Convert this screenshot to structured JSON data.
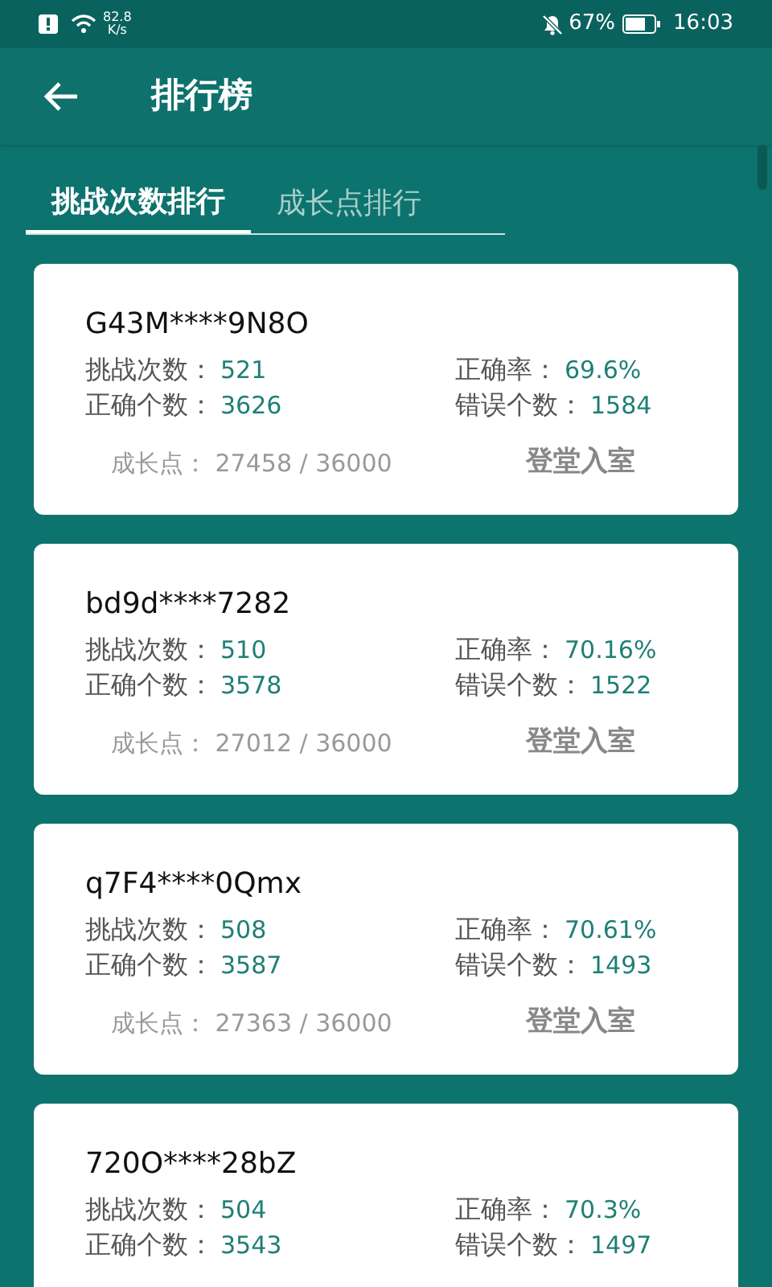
{
  "status_bar": {
    "speed": "82.8",
    "speed_unit": "K/s",
    "battery": "67%",
    "time": "16:03"
  },
  "app_bar": {
    "title": "排行榜"
  },
  "tabs": [
    {
      "label": "挑战次数排行",
      "selected": true
    },
    {
      "label": "成长点排行",
      "selected": false
    }
  ],
  "entries": [
    {
      "user": "G43M****9N8O",
      "challenges_label": "挑战次数：",
      "challenges": "521",
      "accuracy_label": "正确率：",
      "accuracy": "69.6%",
      "correct_label": "正确个数：",
      "correct": "3626",
      "wrong_label": "错误个数：",
      "wrong": "1584",
      "growth": "成长点：  27458 / 36000",
      "rank": "登堂入室"
    },
    {
      "user": "bd9d****7282",
      "challenges_label": "挑战次数：",
      "challenges": "510",
      "accuracy_label": "正确率：",
      "accuracy": "70.16%",
      "correct_label": "正确个数：",
      "correct": "3578",
      "wrong_label": "错误个数：",
      "wrong": "1522",
      "growth": "成长点：  27012 / 36000",
      "rank": "登堂入室"
    },
    {
      "user": "q7F4****0Qmx",
      "challenges_label": "挑战次数：",
      "challenges": "508",
      "accuracy_label": "正确率：",
      "accuracy": "70.61%",
      "correct_label": "正确个数：",
      "correct": "3587",
      "wrong_label": "错误个数：",
      "wrong": "1493",
      "growth": "成长点：  27363 / 36000",
      "rank": "登堂入室"
    },
    {
      "user": "720O****28bZ",
      "challenges_label": "挑战次数：",
      "challenges": "504",
      "accuracy_label": "正确率：",
      "accuracy": "70.3%",
      "correct_label": "正确个数：",
      "correct": "3543",
      "wrong_label": "错误个数：",
      "wrong": "1497"
    }
  ]
}
